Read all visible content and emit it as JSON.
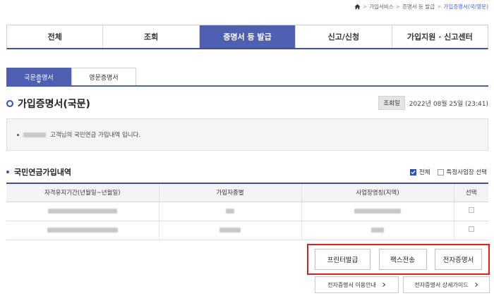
{
  "breadcrumb": {
    "items": [
      "가입서비스",
      "증명서 등 발급"
    ],
    "current": "가입증명서(국/영문)"
  },
  "main_tabs": [
    {
      "label": "전체",
      "active": false
    },
    {
      "label": "조회",
      "active": false
    },
    {
      "label": "증명서 등 발급",
      "active": true
    },
    {
      "label": "신고/신청",
      "active": false
    },
    {
      "label": "가입지원 · 신고센터",
      "active": false
    }
  ],
  "sub_tabs": [
    {
      "label": "국문증명서",
      "active": true
    },
    {
      "label": "영문증명서",
      "active": false
    }
  ],
  "section": {
    "title": "가입증명서(국문)",
    "inquiry_label": "조회일",
    "inquiry_value": "2022년 08월 25일 (23:41)"
  },
  "info": {
    "message": "고객님의 국민연금 가입내역 입니다."
  },
  "subsection": {
    "title": "국민연금가입내역",
    "filter_all": "전체",
    "filter_all_checked": true,
    "filter_specific": "특정사업장 선택",
    "filter_specific_checked": false
  },
  "table": {
    "headers": [
      "자격유지기간(년월일~년월일)",
      "가입자종별",
      "사업장명칭(지역)",
      "선택"
    ]
  },
  "buttons": {
    "print": "프린터발급",
    "fax": "팩스전송",
    "ecert": "전자증명서"
  },
  "guides": {
    "usage": "전자증명서 이용안내",
    "detail": "전자증명서 상세가이드"
  },
  "colors": {
    "accent": "#4f5fb2",
    "highlight": "#e02020"
  }
}
